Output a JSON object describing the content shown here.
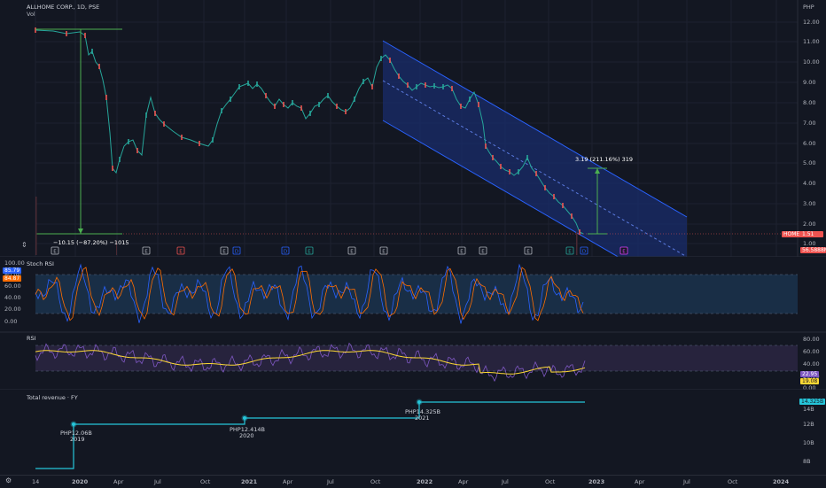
{
  "header": {
    "symbol_line": "ALLHOME CORP., 1D, PSE",
    "vol_label": "Vol",
    "currency": "PHP"
  },
  "price_scale": [
    "12.00",
    "11.00",
    "10.00",
    "9.00",
    "8.00",
    "7.00",
    "6.00",
    "5.00",
    "4.00",
    "3.00",
    "2.00",
    "1.00"
  ],
  "price_tags": {
    "symbol": "HOME",
    "last_price": "1.51",
    "volume": "56.5888M"
  },
  "annotations": {
    "drawdown": "−10.15 (−87.20%) −1015",
    "rebound": "3.19 (211.16%) 319"
  },
  "event_markers": [
    "E",
    "E",
    "E",
    "E",
    "D",
    "D",
    "E",
    "E",
    "E",
    "E",
    "E",
    "E",
    "E",
    "D",
    "E"
  ],
  "stoch_rsi": {
    "title": "Stoch RSI",
    "scale": [
      "100.00",
      "80.00",
      "60.00",
      "40.00",
      "20.00",
      "0.00"
    ],
    "k_value": "85.79",
    "d_value": "84.87",
    "k_color": "#2962ff",
    "d_color": "#ff6d00"
  },
  "rsi": {
    "title": "RSI",
    "scale": [
      "80.00",
      "60.00",
      "40.00",
      "20.00",
      "0.00"
    ],
    "rsi_value": "22.95",
    "ma_value": "19.08",
    "rsi_color": "#7e57c2",
    "ma_color": "#fdd835"
  },
  "revenue": {
    "title": "Total revenue · FY",
    "scale": [
      "14B",
      "12B",
      "10B",
      "8B"
    ],
    "current_tag": "14.325B",
    "points": [
      {
        "value": "PHP12.06B",
        "year": "2019"
      },
      {
        "value": "PHP12.414B",
        "year": "2020"
      },
      {
        "value": "PHP14.325B",
        "year": "2021"
      }
    ]
  },
  "time_axis": [
    "14",
    "2020",
    "Apr",
    "Jul",
    "Oct",
    "2021",
    "Apr",
    "Jul",
    "Oct",
    "2022",
    "Apr",
    "Jul",
    "Oct",
    "2023",
    "Apr",
    "Jul",
    "Oct",
    "2024"
  ],
  "colors": {
    "background": "#131722",
    "up": "#26a69a",
    "down": "#ef5350",
    "channel": "#2962ff",
    "measure": "#4caf50",
    "revenue": "#26c6da"
  }
}
